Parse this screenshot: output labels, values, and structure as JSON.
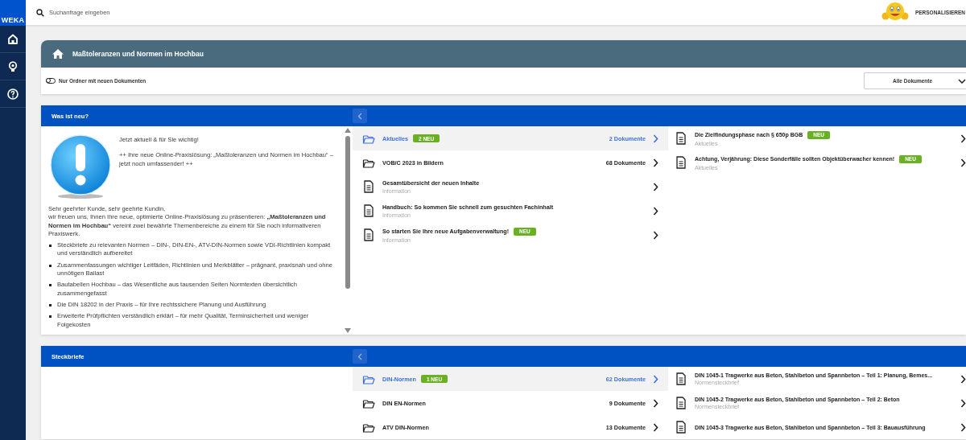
{
  "logo": "WEKA",
  "search": {
    "placeholder": "Suchanfrage eingeben"
  },
  "personalize": "PERSONALISIEREN",
  "sidebar": {
    "items": [
      {
        "kind": "home"
      },
      {
        "kind": "bulb"
      },
      {
        "kind": "help"
      }
    ]
  },
  "header": {
    "title": "Maßtoleranzen und Normen im Hochbau",
    "toggle": {
      "label": "Nur Ordner mit neuen Dokumenten",
      "on": false
    },
    "dropdown": {
      "value": "Alle Dokumente"
    }
  },
  "sections": [
    {
      "title": "Was ist neu?",
      "intro": {
        "headline": "Jetzt aktuell & für Sie wichtig!",
        "teaser": "++ Ihre neue Online-Praxislösung: „Maßtoleranzen und Normen im Hochbau“ – jetzt noch umfassender! ++",
        "greeting": "Sehr geehrter Kunde, sehr geehrte Kundin,",
        "paragraph": "wir freuen uns, Ihnen Ihre neue, optimierte Online-Praxislösung zu präsentieren: **„Maßtoleranzen und Normen im Hochbau“** vereint zwei bewährte Themenbereiche zu einem für Sie noch informativeren Praxiswerk.",
        "bullets": [
          "Steckbriefe zu relevanten Normen – DIN-, DIN-EN-, ATV-DIN-Normen sowie VDI-Richtlinien kompakt und verständlich aufbereitet",
          "Zusammenfassungen wichtiger Leitfäden, Richtlinien und Merkblätter – prägnant, praxisnah und ohne unnötigen Ballast",
          "Bautabellen Hochbau – das Wesentliche aus tausenden Seiten Normtexten übersichtlich zusammengefasst",
          "Die DIN 18202 in der Praxis – für Ihre rechtssichere Planung und Ausführung",
          "Erweiterte Prüfpflichten verständlich erklärt – für mehr Qualität, Terminsicherheit und weniger Folgekosten"
        ]
      },
      "items": [
        {
          "kind": "folder",
          "title": "Aktuelles",
          "badge": "2 NEU",
          "count": "2 Dokumente",
          "selected": true
        },
        {
          "kind": "folder",
          "title": "VOB/C 2023 in Bildern",
          "count": "68 Dokumente",
          "selected": false
        },
        {
          "kind": "document",
          "title": "Gesamtübersicht der neuen Inhalte",
          "subtitle": "Information",
          "selected": false
        },
        {
          "kind": "document",
          "title": "Handbuch: So kommen Sie schnell zum gesuchten Fachinhalt",
          "subtitle": "Information",
          "selected": false
        },
        {
          "kind": "document",
          "title": "So starten Sie Ihre neue Aufgabenverwaltung!",
          "badge": "NEU",
          "subtitle": "Information",
          "selected": false
        }
      ],
      "documents": [
        {
          "title": "Die Zielfindungsphase nach § 650p BGB",
          "badge": "NEU",
          "subtitle": "Aktuelles"
        },
        {
          "title": "Achtung, Verjährung: Diese Sonderfälle sollten Objektüberwacher kennen!",
          "badge": "NEU",
          "subtitle": "Aktuelles"
        }
      ]
    },
    {
      "title": "Steckbriefe",
      "items": [
        {
          "kind": "folder",
          "title": "DIN-Normen",
          "badge": "1 NEU",
          "count": "62 Dokumente",
          "selected": true
        },
        {
          "kind": "folder",
          "title": "DIN EN-Normen",
          "count": "9 Dokumente",
          "selected": false
        },
        {
          "kind": "folder",
          "title": "ATV DIN-Normen",
          "count": "13 Dokumente",
          "selected": false
        }
      ],
      "documents": [
        {
          "title": "DIN 1045-1 Tragwerke aus Beton, Stahlbeton und Spannbeton – Teil 1: Planung, Bemes...",
          "subtitle": "Normensteckbrief"
        },
        {
          "title": "DIN 1045-2 Tragwerke aus Beton, Stahlbeton und Spannbeton – Teil 2: Beton",
          "subtitle": "Normensteckbrief"
        },
        {
          "title": "DIN 1045-3 Tragwerke aus Beton, Stahlbeton und Spannbeton – Teil 3: Bauausführung"
        }
      ]
    }
  ]
}
